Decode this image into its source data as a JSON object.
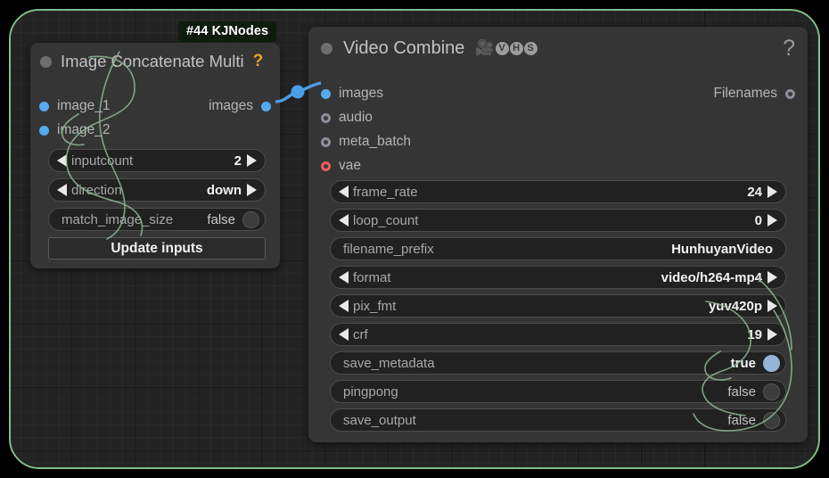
{
  "canvas": {
    "accent_border_color": "#7fc08a",
    "background_color": "#232323",
    "annotation_stroke_color": "#8fb894"
  },
  "badge": {
    "label": "#44 KJNodes",
    "background": "#0e1c0e",
    "text_color": "#ffffff"
  },
  "nodes": [
    {
      "id": "image-concatenate-multi",
      "title": "Image Concatenate Multi",
      "help_icon": "question-mark-icon",
      "collapse_icon": "collapse-dot-icon",
      "inputs": [
        {
          "name": "image_1",
          "dot": "solid",
          "color": "#55aaf0"
        },
        {
          "name": "image_2",
          "dot": "solid",
          "color": "#55aaf0"
        }
      ],
      "outputs": [
        {
          "name": "images",
          "dot": "solid",
          "color": "#55aaf0"
        }
      ],
      "widgets": [
        {
          "name": "inputcount",
          "value": "2",
          "type": "number-stepper"
        },
        {
          "name": "direction",
          "value": "down",
          "type": "combo-stepper"
        },
        {
          "name": "match_image_size",
          "value": "false",
          "type": "toggle",
          "on": false
        }
      ],
      "button": {
        "label": "Update inputs"
      }
    },
    {
      "id": "video-combine",
      "title": "Video Combine",
      "title_icons": [
        "movie-camera-icon",
        "circled-v-icon",
        "circled-h-icon",
        "circled-s-icon"
      ],
      "title_icon_glyph": "🎥",
      "circled_letters": [
        "V",
        "H",
        "S"
      ],
      "help_icon": "question-mark-icon",
      "collapse_icon": "collapse-dot-icon",
      "inputs": [
        {
          "name": "images",
          "dot": "solid",
          "color": "#55aaf0"
        },
        {
          "name": "audio",
          "dot": "ring",
          "color": "#8d8d9b"
        },
        {
          "name": "meta_batch",
          "dot": "ring",
          "color": "#8d8d9b"
        },
        {
          "name": "vae",
          "dot": "ring",
          "color": "#f05a5a"
        }
      ],
      "outputs": [
        {
          "name": "Filenames",
          "dot": "ring",
          "color": "#8d8d9b"
        }
      ],
      "widgets": [
        {
          "name": "frame_rate",
          "value": "24",
          "type": "number-stepper"
        },
        {
          "name": "loop_count",
          "value": "0",
          "type": "number-stepper"
        },
        {
          "name": "filename_prefix",
          "value": "HunhuyanVideo",
          "type": "text"
        },
        {
          "name": "format",
          "value": "video/h264-mp4",
          "type": "combo-stepper"
        },
        {
          "name": "pix_fmt",
          "value": "yuv420p",
          "type": "combo-stepper"
        },
        {
          "name": "crf",
          "value": "19",
          "type": "number-stepper"
        },
        {
          "name": "save_metadata",
          "value": "true",
          "type": "toggle",
          "on": true
        },
        {
          "name": "pingpong",
          "value": "false",
          "type": "toggle",
          "on": false
        },
        {
          "name": "save_output",
          "value": "false",
          "type": "toggle",
          "on": false
        }
      ]
    }
  ],
  "link": {
    "from": "images",
    "to": "images",
    "color": "#4a9eea"
  }
}
